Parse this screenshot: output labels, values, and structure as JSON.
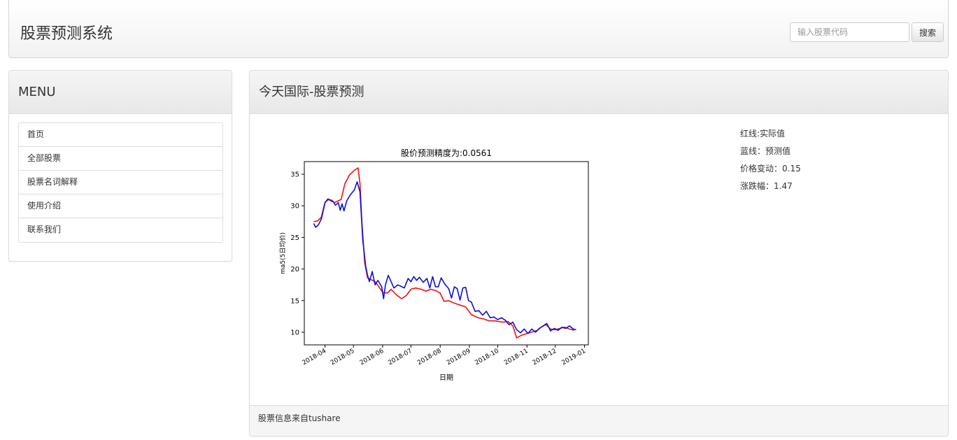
{
  "navbar": {
    "title": "股票预测系统",
    "search_placeholder": "输入股票代码",
    "search_button": "搜索"
  },
  "sidebar": {
    "heading": "MENU",
    "items": [
      {
        "label": "首页"
      },
      {
        "label": "全部股票"
      },
      {
        "label": "股票名词解释"
      },
      {
        "label": "使用介绍"
      },
      {
        "label": "联系我们"
      }
    ]
  },
  "main": {
    "heading": "今天国际-股票预测",
    "stats": [
      "红线:实际值",
      "蓝线：预测值",
      "价格变动：0.15",
      "涨跌幅：1.47"
    ],
    "footer": "股票信息来自tushare"
  },
  "colors": {
    "actual": "#ee1111",
    "predicted": "#1111cc"
  },
  "chart_data": {
    "type": "line",
    "title": "股价预测精度为:0.0561",
    "xlabel": "日期",
    "ylabel": "ma5(5日均价)",
    "xlim": [
      "2018-03-10",
      "2019-01-05"
    ],
    "ylim": [
      8,
      37
    ],
    "yticks": [
      10,
      15,
      20,
      25,
      30,
      35
    ],
    "xticks": [
      "2018-04",
      "2018-05",
      "2018-06",
      "2018-07",
      "2018-08",
      "2018-09",
      "2018-10",
      "2018-11",
      "2018-12",
      "2019-01"
    ],
    "grid": false,
    "series": [
      {
        "name": "实际值",
        "color": "red",
        "points": [
          [
            "2018-03-20",
            27.5
          ],
          [
            "2018-03-24",
            27.6
          ],
          [
            "2018-03-28",
            28.2
          ],
          [
            "2018-04-01",
            30.6
          ],
          [
            "2018-04-05",
            31.0
          ],
          [
            "2018-04-08",
            30.9
          ],
          [
            "2018-04-11",
            30.5
          ],
          [
            "2018-04-15",
            30.8
          ],
          [
            "2018-04-18",
            31.0
          ],
          [
            "2018-04-22",
            33.5
          ],
          [
            "2018-04-27",
            34.9
          ],
          [
            "2018-05-02",
            35.6
          ],
          [
            "2018-05-06",
            36.0
          ],
          [
            "2018-05-08",
            33.5
          ],
          [
            "2018-05-10",
            27.5
          ],
          [
            "2018-05-13",
            21.0
          ],
          [
            "2018-05-16",
            18.6
          ],
          [
            "2018-05-20",
            18.3
          ],
          [
            "2018-05-24",
            18.0
          ],
          [
            "2018-05-28",
            17.2
          ],
          [
            "2018-06-01",
            16.3
          ],
          [
            "2018-06-06",
            16.2
          ],
          [
            "2018-06-10",
            16.8
          ],
          [
            "2018-06-15",
            16.0
          ],
          [
            "2018-06-21",
            15.3
          ],
          [
            "2018-06-26",
            15.8
          ],
          [
            "2018-07-01",
            16.8
          ],
          [
            "2018-07-06",
            17.0
          ],
          [
            "2018-07-12",
            16.8
          ],
          [
            "2018-07-17",
            16.5
          ],
          [
            "2018-07-22",
            16.8
          ],
          [
            "2018-07-27",
            16.6
          ],
          [
            "2018-08-01",
            16.2
          ],
          [
            "2018-08-05",
            14.9
          ],
          [
            "2018-08-10",
            15.0
          ],
          [
            "2018-08-16",
            14.6
          ],
          [
            "2018-08-22",
            14.3
          ],
          [
            "2018-08-28",
            14.0
          ],
          [
            "2018-09-03",
            12.8
          ],
          [
            "2018-09-10",
            12.3
          ],
          [
            "2018-09-16",
            12.1
          ],
          [
            "2018-09-22",
            11.8
          ],
          [
            "2018-09-28",
            11.8
          ],
          [
            "2018-10-06",
            11.6
          ],
          [
            "2018-10-12",
            11.7
          ],
          [
            "2018-10-17",
            11.0
          ],
          [
            "2018-10-21",
            9.1
          ],
          [
            "2018-10-26",
            9.5
          ],
          [
            "2018-11-01",
            9.8
          ],
          [
            "2018-11-06",
            10.0
          ],
          [
            "2018-11-12",
            10.3
          ],
          [
            "2018-11-16",
            10.8
          ],
          [
            "2018-11-21",
            11.2
          ],
          [
            "2018-11-26",
            10.5
          ],
          [
            "2018-12-01",
            10.4
          ],
          [
            "2018-12-06",
            10.6
          ],
          [
            "2018-12-11",
            10.8
          ],
          [
            "2018-12-16",
            10.5
          ],
          [
            "2018-12-21",
            10.3
          ]
        ]
      },
      {
        "name": "预测值",
        "color": "blue",
        "points": [
          [
            "2018-03-20",
            27.2
          ],
          [
            "2018-03-22",
            26.6
          ],
          [
            "2018-03-25",
            27.0
          ],
          [
            "2018-03-28",
            27.9
          ],
          [
            "2018-04-01",
            30.5
          ],
          [
            "2018-04-04",
            31.1
          ],
          [
            "2018-04-07",
            30.8
          ],
          [
            "2018-04-10",
            30.6
          ],
          [
            "2018-04-12",
            30.1
          ],
          [
            "2018-04-15",
            30.5
          ],
          [
            "2018-04-17",
            29.3
          ],
          [
            "2018-04-19",
            30.3
          ],
          [
            "2018-04-21",
            29.2
          ],
          [
            "2018-04-24",
            30.8
          ],
          [
            "2018-04-28",
            31.8
          ],
          [
            "2018-05-02",
            32.5
          ],
          [
            "2018-05-05",
            33.8
          ],
          [
            "2018-05-08",
            32.2
          ],
          [
            "2018-05-11",
            24.5
          ],
          [
            "2018-05-14",
            20.5
          ],
          [
            "2018-05-16",
            19.0
          ],
          [
            "2018-05-18",
            18.0
          ],
          [
            "2018-05-21",
            19.6
          ],
          [
            "2018-05-24",
            17.5
          ],
          [
            "2018-05-27",
            18.2
          ],
          [
            "2018-05-31",
            17.2
          ],
          [
            "2018-06-02",
            15.3
          ],
          [
            "2018-06-04",
            17.5
          ],
          [
            "2018-06-07",
            19.0
          ],
          [
            "2018-06-10",
            18.0
          ],
          [
            "2018-06-13",
            17.0
          ],
          [
            "2018-06-17",
            17.5
          ],
          [
            "2018-06-20",
            17.3
          ],
          [
            "2018-06-24",
            17.0
          ],
          [
            "2018-06-28",
            18.5
          ],
          [
            "2018-07-01",
            18.0
          ],
          [
            "2018-07-04",
            18.8
          ],
          [
            "2018-07-07",
            18.2
          ],
          [
            "2018-07-10",
            18.7
          ],
          [
            "2018-07-14",
            17.9
          ],
          [
            "2018-07-18",
            18.5
          ],
          [
            "2018-07-21",
            17.0
          ],
          [
            "2018-07-24",
            18.8
          ],
          [
            "2018-07-27",
            17.2
          ],
          [
            "2018-07-30",
            17.2
          ],
          [
            "2018-08-02",
            18.6
          ],
          [
            "2018-08-06",
            17.6
          ],
          [
            "2018-08-10",
            16.9
          ],
          [
            "2018-08-13",
            15.4
          ],
          [
            "2018-08-16",
            17.2
          ],
          [
            "2018-08-19",
            16.9
          ],
          [
            "2018-08-22",
            15.1
          ],
          [
            "2018-08-25",
            17.0
          ],
          [
            "2018-08-28",
            17.1
          ],
          [
            "2018-08-31",
            15.0
          ],
          [
            "2018-09-03",
            14.8
          ],
          [
            "2018-09-07",
            13.3
          ],
          [
            "2018-09-11",
            13.4
          ],
          [
            "2018-09-15",
            12.7
          ],
          [
            "2018-09-19",
            13.3
          ],
          [
            "2018-09-23",
            12.3
          ],
          [
            "2018-09-27",
            12.4
          ],
          [
            "2018-10-01",
            12.0
          ],
          [
            "2018-10-05",
            12.3
          ],
          [
            "2018-10-09",
            11.9
          ],
          [
            "2018-10-13",
            11.2
          ],
          [
            "2018-10-17",
            11.6
          ],
          [
            "2018-10-21",
            10.4
          ],
          [
            "2018-10-25",
            9.9
          ],
          [
            "2018-10-29",
            10.5
          ],
          [
            "2018-11-02",
            9.8
          ],
          [
            "2018-11-06",
            10.5
          ],
          [
            "2018-11-10",
            10.0
          ],
          [
            "2018-11-14",
            10.6
          ],
          [
            "2018-11-18",
            11.0
          ],
          [
            "2018-11-22",
            11.4
          ],
          [
            "2018-11-26",
            10.2
          ],
          [
            "2018-11-30",
            10.6
          ],
          [
            "2018-12-04",
            10.3
          ],
          [
            "2018-12-08",
            10.8
          ],
          [
            "2018-12-12",
            10.6
          ],
          [
            "2018-12-16",
            11.0
          ],
          [
            "2018-12-20",
            10.5
          ],
          [
            "2018-12-23",
            10.4
          ]
        ]
      }
    ]
  }
}
